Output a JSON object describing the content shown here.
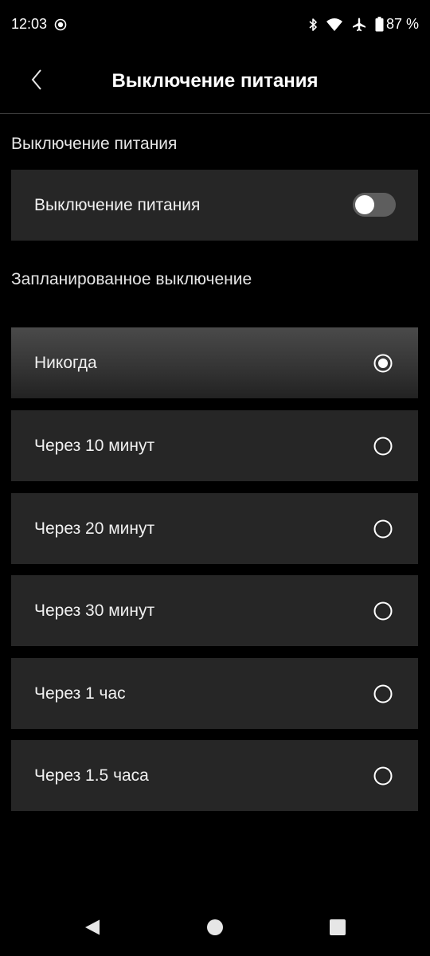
{
  "status_bar": {
    "time": "12:03",
    "battery_percent": "87 %",
    "icons": [
      "screen-record-icon",
      "bluetooth-icon",
      "wifi-icon",
      "airplane-mode-icon",
      "battery-icon"
    ]
  },
  "header": {
    "title": "Выключение питания",
    "back_icon": "chevron-left-icon"
  },
  "power_section": {
    "title": "Выключение питания",
    "toggle_label": "Выключение питания",
    "toggle_on": false
  },
  "schedule_section": {
    "title": "Запланированное выключение",
    "selected_index": 0,
    "options": [
      {
        "label": "Никогда"
      },
      {
        "label": "Через 10 минут"
      },
      {
        "label": "Через 20 минут"
      },
      {
        "label": "Через 30 минут"
      },
      {
        "label": "Через 1 час"
      },
      {
        "label": "Через 1.5 часа"
      }
    ]
  },
  "nav_bar": {
    "icons": [
      "back-triangle-icon",
      "home-circle-icon",
      "recents-square-icon"
    ]
  },
  "colors": {
    "background": "#000000",
    "card": "#262626",
    "selected_card_top": "#4a4a4a",
    "text": "#f0f0f0",
    "toggle_track_off": "#5e5e5e"
  }
}
